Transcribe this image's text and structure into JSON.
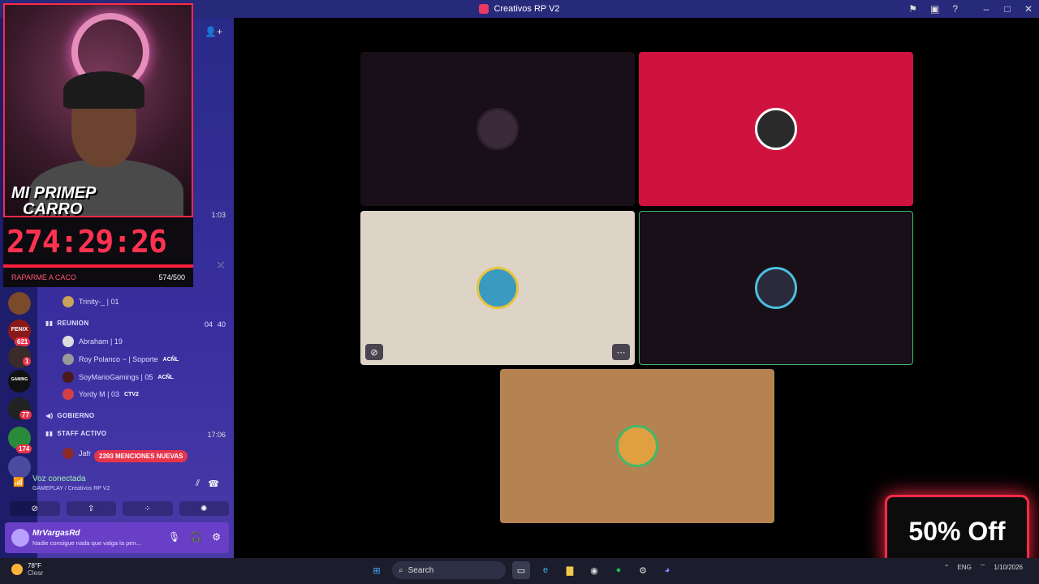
{
  "window": {
    "title": "Creativos RP V2"
  },
  "webcam": {
    "overlay_line1": "MI PRIMEP",
    "overlay_line2": "CARRO",
    "timer": "274:29:26",
    "goal_label": "RAPARME A CACO",
    "goal_count": "574/500"
  },
  "rail": {
    "servers": [
      {
        "label": "",
        "badge": ""
      },
      {
        "label": "FENIX",
        "badge": "621"
      },
      {
        "label": "",
        "badge": "1"
      },
      {
        "label": "GAMING",
        "badge": ""
      },
      {
        "label": "",
        "badge": "77"
      },
      {
        "label": "",
        "badge": "174"
      }
    ]
  },
  "sidebar": {
    "time_top": "1:03",
    "trinity": "Trinity-_ | 01",
    "reunion": {
      "name": "REUNION",
      "count1": "04",
      "count2": "40"
    },
    "reunion_users": [
      {
        "name": "Abraham | 19",
        "tag": ""
      },
      {
        "name": "Roy Polanco ~ | Soporte",
        "tag": "ACÑL"
      },
      {
        "name": "SoyMarioGamings | 05",
        "tag": "ACÑL"
      },
      {
        "name": "Yordy M | 03",
        "tag": "CTV2"
      }
    ],
    "gobierno": "GOBIERNO",
    "staff": {
      "name": "STAFF ACTIVO",
      "time": "17:06"
    },
    "staff_user": "Jafr",
    "mentions": "2393 MENCIONES NUEVAS"
  },
  "voice": {
    "title": "Voz conectada",
    "subtitle_channel": "GAMEPLAY",
    "subtitle_server": "/ Creativos RP V2"
  },
  "user": {
    "name": "MrVargasRd",
    "status": "Nadie consigue nada que valga la pen..."
  },
  "promo": {
    "text": "50% Off"
  },
  "taskbar": {
    "weather_temp": "78°F",
    "weather_desc": "Clear",
    "search_label": "Search",
    "lang": "ENG",
    "date": "1/10/2026"
  },
  "colors": {
    "tile1": "#190f18",
    "tile2": "#d0123f",
    "tile3": "#ddd3c7",
    "tile4": "#190f18",
    "tile5": "#b58351",
    "speaking_outline": "#3fb96a"
  }
}
